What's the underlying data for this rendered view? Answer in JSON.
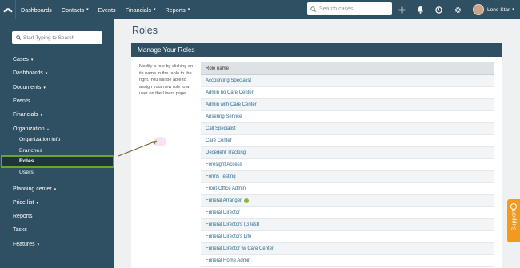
{
  "topbar": {
    "nav": [
      {
        "label": "Dashboards",
        "caret": false
      },
      {
        "label": "Contacts",
        "caret": true
      },
      {
        "label": "Events",
        "caret": false
      },
      {
        "label": "Financials",
        "caret": true
      },
      {
        "label": "Reports",
        "caret": true
      }
    ],
    "search_placeholder": "Search cases",
    "user_name": "Lone Star"
  },
  "sidebar": {
    "search_placeholder": "Start Typing to Search",
    "items": {
      "cases": "Cases",
      "dashboards": "Dashboards",
      "documents": "Documents",
      "events": "Events",
      "financials": "Financials",
      "organization": "Organization",
      "organization_info": "Organization info",
      "branches": "Branches",
      "roles": "Roles",
      "users": "Users",
      "planning_center": "Planning center",
      "price_list": "Price list",
      "reports": "Reports",
      "tasks": "Tasks",
      "features": "Features"
    }
  },
  "main": {
    "title": "Roles",
    "panel_title": "Manage Your Roles",
    "help_text": "Modify a role by clicking on its name in the table to the right. You will be able to assign your new role to a user on the Users page.",
    "table_header": "Role name",
    "roles": [
      "Accounting Specialist",
      "Admin no Care Center",
      "Admin with Care Center",
      "Ansering Service",
      "Call Specialist",
      "Care Center",
      "Decedent Tracking",
      "Foresight Access",
      "Forms Testing",
      "Front-Office Admin",
      "Funeral Arranger",
      "Funeral Director",
      "Funeral Directors (GTest)",
      "Funeral Directors Life",
      "Funeral Director w/ Care Center",
      "Funeral Home Admin"
    ]
  },
  "support_label": "Support",
  "colors": {
    "nav_bg": "#2f4f63",
    "active_border": "#6aa62e",
    "support_tab": "#f29a1e",
    "link": "#2f6a8a"
  }
}
